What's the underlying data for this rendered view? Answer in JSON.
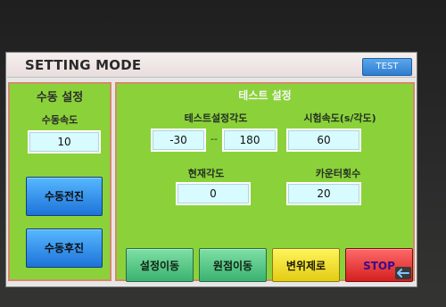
{
  "window": {
    "title": "SETTING MODE",
    "test_button": "TEST"
  },
  "manual": {
    "title": "수동 설정",
    "speed_label": "수동속도",
    "speed_value": "10",
    "forward_button": "수동전진",
    "backward_button": "수동후진"
  },
  "test": {
    "title": "테스트 설정",
    "set_angle_label": "테스트설정각도",
    "angle_from": "-30",
    "angle_separator": "--",
    "angle_to": "180",
    "speed_label": "시험속도(s/각도)",
    "speed_value": "60",
    "current_angle_label": "현재각도",
    "current_angle_value": "0",
    "counter_label": "카운터횟수",
    "counter_value": "20"
  },
  "actions": {
    "move_setpoint": "설정이동",
    "move_origin": "원점이동",
    "zero_displacement": "변위제로",
    "stop": "STOP"
  },
  "icons": {
    "back": "back-arrow-icon"
  },
  "colors": {
    "panel_green": "#8bd23a",
    "panel_border": "#d38a69",
    "field_bg": "#d7fbff",
    "blue_button": "#2f86e6",
    "green_button": "#49c07e",
    "yellow_button": "#f2e02a",
    "red_button": "#e63a3a",
    "stop_text": "#3b0b8a"
  }
}
